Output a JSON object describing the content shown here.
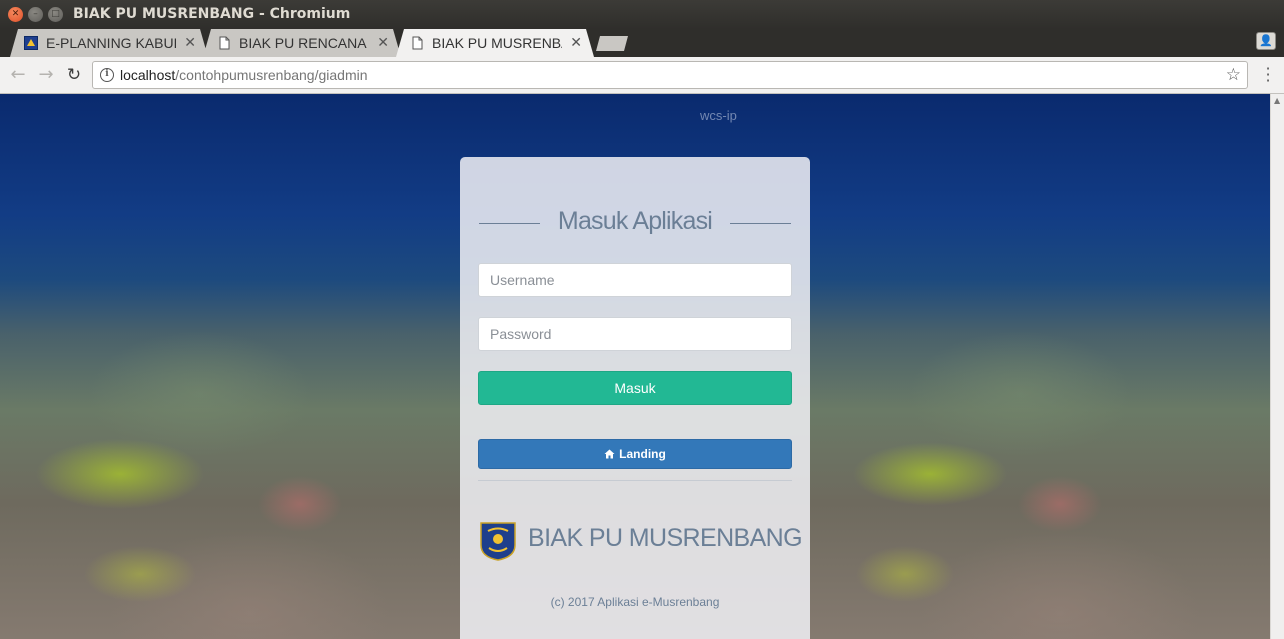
{
  "window": {
    "title": "BIAK PU MUSRENBANG - Chromium"
  },
  "tabs": [
    {
      "title": "E-PLANNING KABUPATEN",
      "icon": "logo-icon"
    },
    {
      "title": "BIAK PU RENCANA",
      "icon": "page-icon"
    },
    {
      "title": "BIAK PU MUSRENBANG",
      "icon": "page-icon"
    }
  ],
  "address": {
    "host": "localhost",
    "path": "/contohpumusrenbang/giadmin"
  },
  "page": {
    "watermark": "wcs-ip",
    "title": "Masuk Aplikasi",
    "username_placeholder": "Username",
    "password_placeholder": "Password",
    "login_label": "Masuk",
    "landing_label": "Landing",
    "brand": "BIAK PU MUSRENBANG",
    "footer": "(c) 2017 Aplikasi e-Musrenbang"
  },
  "colors": {
    "login_button": "#22b894",
    "landing_button": "#3378b9",
    "heading_text": "#6b7f96"
  }
}
